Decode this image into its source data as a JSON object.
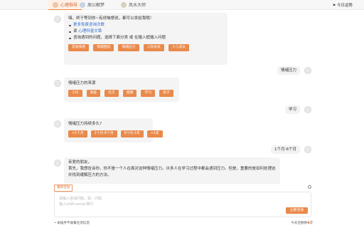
{
  "colors": {
    "accent": "#e98a4b",
    "link": "#2f6fd1",
    "bubble": "#f4f4f4"
  },
  "header": {
    "tabs": [
      {
        "label": "心理指导",
        "icon": "heart-icon",
        "active": true
      },
      {
        "label": "周公解梦",
        "icon": "moon-icon",
        "active": false
      },
      {
        "label": "风水大师",
        "icon": "compass-icon",
        "active": false
      }
    ],
    "today_label": "今日运势"
  },
  "messages": {
    "welcome": {
      "greeting": "嗨，终于等到你~有烦恼想说，都可以发给我哦！",
      "items": [
        {
          "prefix": "",
          "link": "更多免费咨询次数"
        },
        {
          "prefix": "读 ",
          "link": "心理科普文章"
        },
        {
          "prefix": "咨询遇到的问题，选择下面分类 或 在输入框输入问题",
          "link": ""
        }
      ],
      "chips": [
        "恋爱情感",
        "情绪困扰",
        "情绪压力",
        "人际关系",
        "少儿成长"
      ]
    },
    "user1": "情绪压力",
    "q_source": {
      "text": "情绪压力的来源",
      "chips": [
        "工作",
        "家庭",
        "社交",
        "健康",
        "学习",
        "孩子"
      ]
    },
    "user2": "学习",
    "q_duration": {
      "text": "情绪压力持续多久?",
      "chips": [
        "<1个月",
        "1个月-6个月",
        "6个月-1年",
        ">1年"
      ]
    },
    "user3": "1个月-6个月",
    "answer": {
      "line1": "亲爱的朋友，",
      "line2": "首先，我想告诉你，你不是一个人在面对这种情绪压力。许多人在学习过程中都会遇到压力。但是，重要的是如何处理这些情绪，",
      "line3": "并找到缓解压力的方法。"
    }
  },
  "input": {
    "reset_label": "重新咨询",
    "placeholder_line1": "请输入咨询问题，如：问题",
    "placeholder_line2": "输入shift+enter换行",
    "send_label": "立即咨询"
  },
  "footer": {
    "note": "• 本插件不收集任何信息",
    "remaining_prefix": "今天还剩余",
    "remaining_count": "9",
    "remaining_suffix": "次"
  }
}
